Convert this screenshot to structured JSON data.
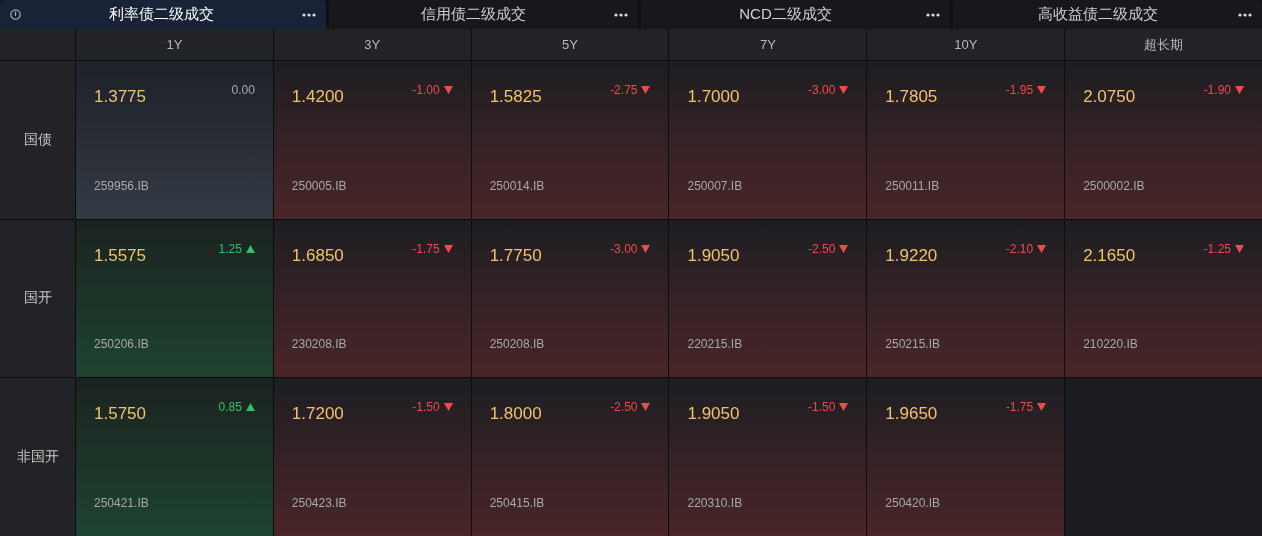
{
  "tabs": [
    {
      "label": "利率债二级成交",
      "selected": true
    },
    {
      "label": "信用债二级成交",
      "selected": false
    },
    {
      "label": "NCD二级成交",
      "selected": false
    },
    {
      "label": "高收益债二级成交",
      "selected": false
    }
  ],
  "table": {
    "columns": [
      "1Y",
      "3Y",
      "5Y",
      "7Y",
      "10Y",
      "超长期"
    ],
    "rows": [
      {
        "label": "国债",
        "cells": [
          {
            "kind": "flat",
            "yield": "1.3775",
            "change": "0.00",
            "code": "259956.IB"
          },
          {
            "kind": "down",
            "yield": "1.4200",
            "change": "-1.00",
            "code": "250005.IB"
          },
          {
            "kind": "down",
            "yield": "1.5825",
            "change": "-2.75",
            "code": "250014.IB"
          },
          {
            "kind": "down",
            "yield": "1.7000",
            "change": "-3.00",
            "code": "250007.IB"
          },
          {
            "kind": "down",
            "yield": "1.7805",
            "change": "-1.95",
            "code": "250011.IB"
          },
          {
            "kind": "down",
            "yield": "2.0750",
            "change": "-1.90",
            "code": "2500002.IB"
          }
        ]
      },
      {
        "label": "国开",
        "cells": [
          {
            "kind": "up",
            "yield": "1.5575",
            "change": "1.25",
            "code": "250206.IB"
          },
          {
            "kind": "down",
            "yield": "1.6850",
            "change": "-1.75",
            "code": "230208.IB"
          },
          {
            "kind": "down",
            "yield": "1.7750",
            "change": "-3.00",
            "code": "250208.IB"
          },
          {
            "kind": "down",
            "yield": "1.9050",
            "change": "-2.50",
            "code": "220215.IB"
          },
          {
            "kind": "down",
            "yield": "1.9220",
            "change": "-2.10",
            "code": "250215.IB"
          },
          {
            "kind": "down",
            "yield": "2.1650",
            "change": "-1.25",
            "code": "210220.IB"
          }
        ]
      },
      {
        "label": "非国开",
        "cells": [
          {
            "kind": "up",
            "yield": "1.5750",
            "change": "0.85",
            "code": "250421.IB"
          },
          {
            "kind": "down",
            "yield": "1.7200",
            "change": "-1.50",
            "code": "250423.IB"
          },
          {
            "kind": "down",
            "yield": "1.8000",
            "change": "-2.50",
            "code": "250415.IB"
          },
          {
            "kind": "down",
            "yield": "1.9050",
            "change": "-1.50",
            "code": "220310.IB"
          },
          {
            "kind": "down",
            "yield": "1.9650",
            "change": "-1.75",
            "code": "250420.IB"
          },
          {
            "kind": "empty"
          }
        ]
      }
    ]
  }
}
